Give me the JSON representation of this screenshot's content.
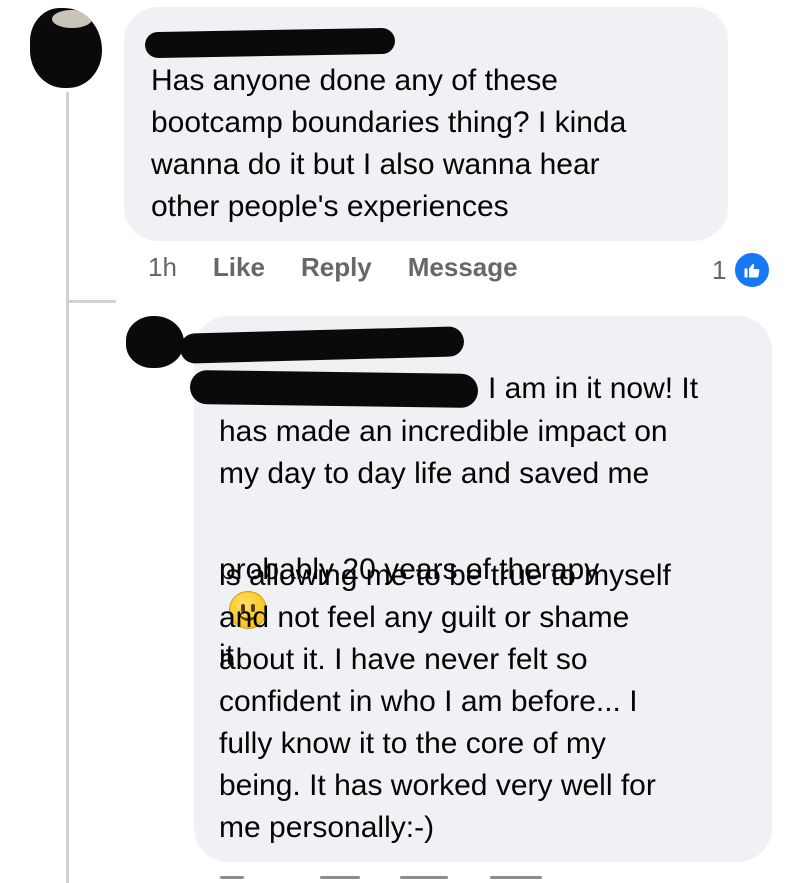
{
  "comment": {
    "text": "Has anyone done any of these\nbootcamp boundaries thing? I kinda\nwanna do it but I also wanna hear\nother people's experiences",
    "time": "1h",
    "like_label": "Like",
    "reply_label": "Reply",
    "message_label": "Message",
    "reaction_count": "1",
    "reaction_icon": "thumbs-up-icon",
    "accent_color": "#1877f2"
  },
  "reply": {
    "line1": "I am in it now! It",
    "line2": "has made an incredible impact on\nmy day to day life and saved me",
    "line3_before": "probably 20 years of therapy",
    "line3_emoji": "slightly-smiling-face-icon",
    "line3_after": "it",
    "line4": "is allowing me to be true to myself\nand not feel any guilt or shame\nabout it. I have never felt so\nconfident in who I am before... I\nfully know it to the core of my\nbeing. It has worked very well for\nme personally:-)"
  }
}
